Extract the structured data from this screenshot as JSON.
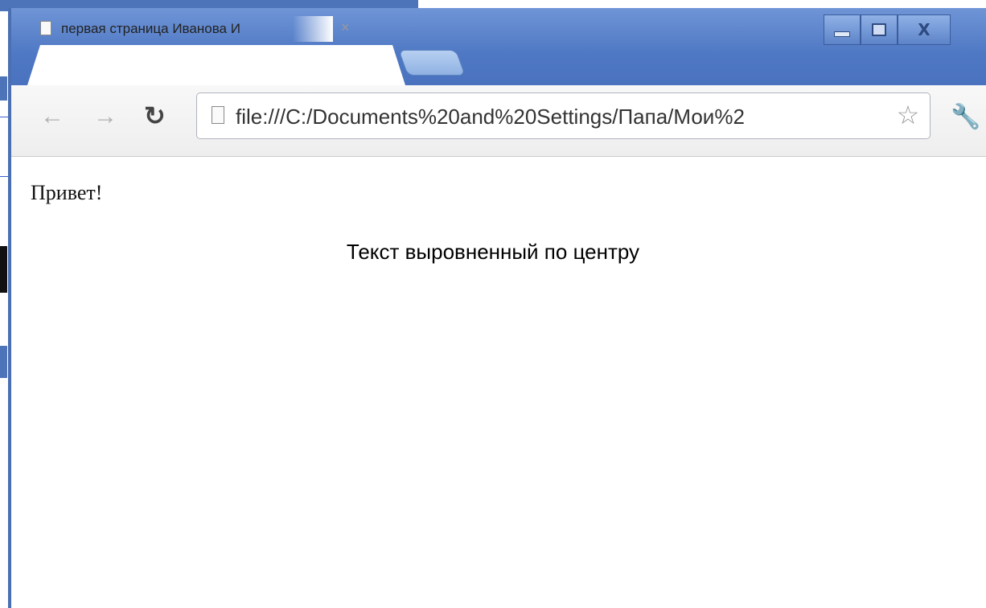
{
  "browser": {
    "tab": {
      "title": "первая страница Иванова И",
      "close_glyph": "×"
    },
    "window_controls": {
      "minimize": "minimize",
      "maximize": "maximize",
      "close_glyph": "X"
    },
    "address_bar": {
      "url": "file:///C:/Documents%20and%20Settings/Папа/Мои%2"
    },
    "icons": {
      "back": "back-arrow-icon",
      "forward": "forward-arrow-icon",
      "reload": "reload-icon",
      "bookmark": "star-icon",
      "menu": "wrench-icon"
    },
    "colors": {
      "titlebar": "#4f78c4",
      "toolbar": "#eeeeee"
    }
  },
  "page": {
    "greeting": "Привет!",
    "centered_text": "Текст выровненный по центру"
  }
}
